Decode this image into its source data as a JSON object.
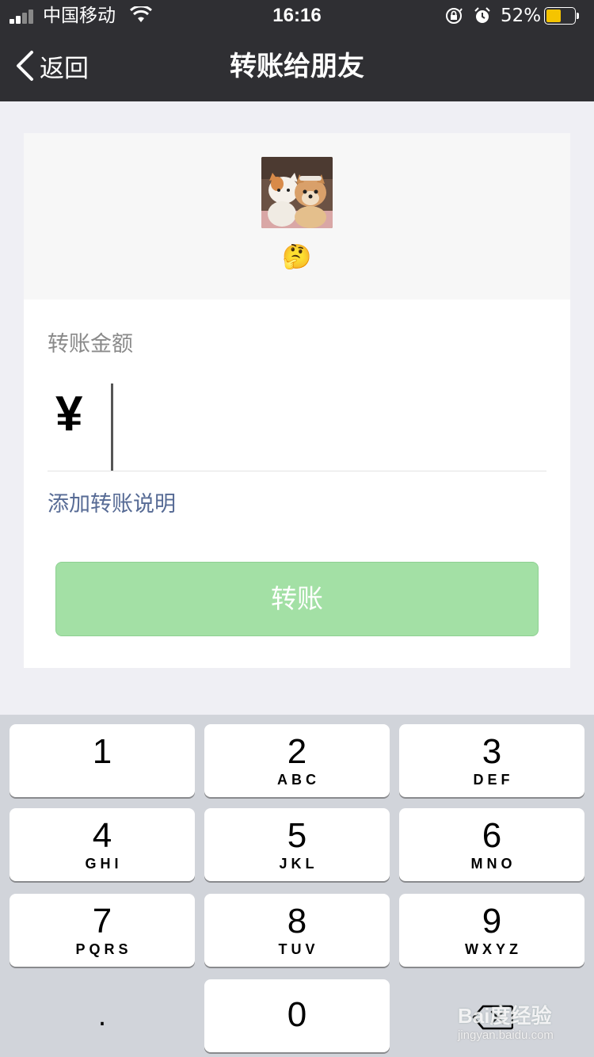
{
  "status_bar": {
    "carrier": "中国移动",
    "time": "16:16",
    "battery_percent": "52%",
    "battery_level": 0.52,
    "icons": [
      "signal-icon",
      "wifi-icon",
      "orientation-lock-icon",
      "alarm-icon",
      "battery-icon"
    ]
  },
  "nav": {
    "back_label": "返回",
    "title": "转账给朋友"
  },
  "recipient": {
    "emoji": "🤔"
  },
  "form": {
    "amount_label": "转账金额",
    "currency_symbol": "¥",
    "amount_value": "",
    "add_note_label": "添加转账说明",
    "submit_label": "转账"
  },
  "keyboard": {
    "keys": [
      {
        "num": "1",
        "letters": ""
      },
      {
        "num": "2",
        "letters": "ABC"
      },
      {
        "num": "3",
        "letters": "DEF"
      },
      {
        "num": "4",
        "letters": "GHI"
      },
      {
        "num": "5",
        "letters": "JKL"
      },
      {
        "num": "6",
        "letters": "MNO"
      },
      {
        "num": "7",
        "letters": "PQRS"
      },
      {
        "num": "8",
        "letters": "TUV"
      },
      {
        "num": "9",
        "letters": "WXYZ"
      }
    ],
    "dot_label": ".",
    "zero_label": "0"
  },
  "watermark": {
    "main": "Bai度经验",
    "sub": "jingyan.baidu.com"
  },
  "colors": {
    "nav_bg": "#2f2f33",
    "page_bg": "#efeff4",
    "link": "#576b95",
    "button_disabled": "#a3e0a5",
    "battery": "#f5c400"
  }
}
